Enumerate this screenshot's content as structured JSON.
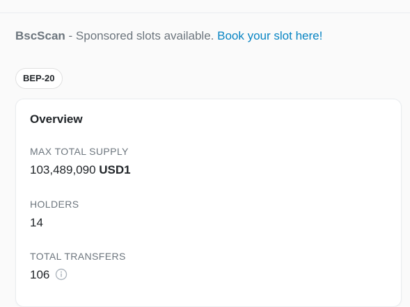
{
  "sponsor": {
    "brand": "BscScan",
    "text": " - Sponsored slots available. ",
    "link_label": "Book your slot here!"
  },
  "token_standard_badge": "BEP-20",
  "overview": {
    "title": "Overview",
    "max_total_supply": {
      "label": "MAX TOTAL SUPPLY",
      "value": "103,489,090",
      "symbol": "USD1"
    },
    "holders": {
      "label": "HOLDERS",
      "value": "14"
    },
    "total_transfers": {
      "label": "TOTAL TRANSFERS",
      "value": "106",
      "icon": "info-circle-icon"
    }
  },
  "colors": {
    "link": "#0784c3",
    "muted": "#6c757d",
    "text": "#212529"
  }
}
